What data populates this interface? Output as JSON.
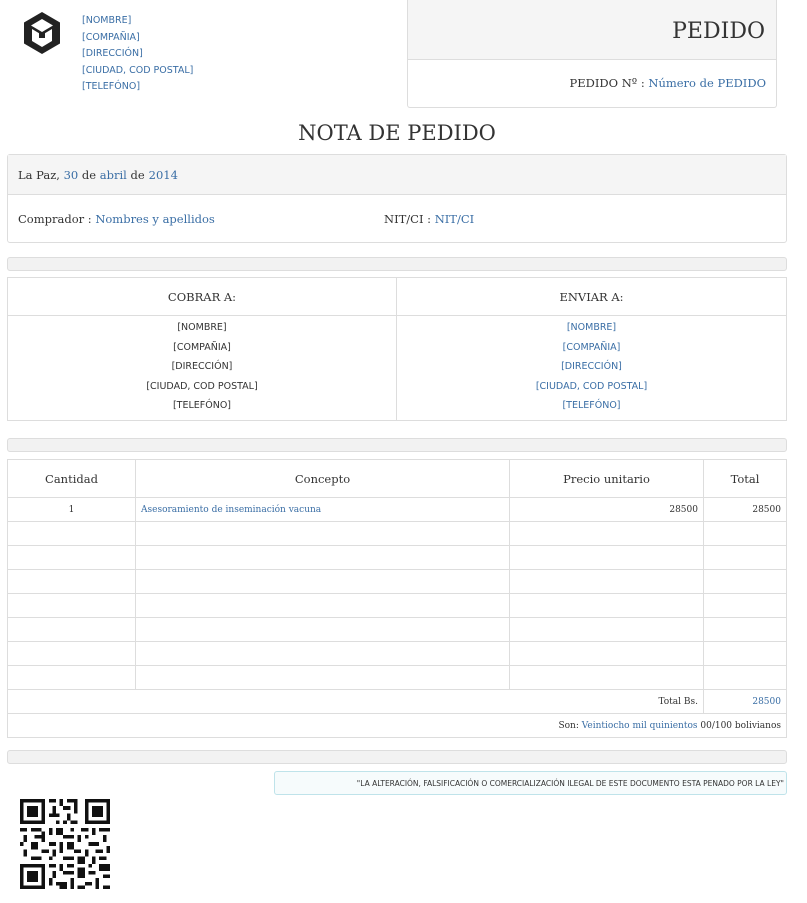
{
  "company": {
    "name": "[NOMBRE]",
    "company": "[COMPAÑIA]",
    "address": "[DIRECCIÓN]",
    "city": "[CIUDAD, COD POSTAL]",
    "phone": "[TELEFÓNO]"
  },
  "order_box": {
    "title": "PEDIDO",
    "number_label": "PEDIDO Nº :",
    "number_value": "Número de PEDIDO"
  },
  "doc_title": "NOTA DE PEDIDO",
  "date": {
    "city": "La Paz,",
    "day": "30",
    "de1": "de",
    "month": "abril",
    "de2": "de",
    "year": "2014"
  },
  "buyer": {
    "label": "Comprador :",
    "value": "Nombres y apellidos",
    "nit_label": "NIT/CI :",
    "nit_value": "NIT/CI"
  },
  "bill_to": {
    "header": "COBRAR A:",
    "name": "[NOMBRE]",
    "company": "[COMPAÑIA]",
    "address": "[DIRECCIÓN]",
    "city": "[CIUDAD, COD POSTAL]",
    "phone": "[TELEFÓNO]"
  },
  "ship_to": {
    "header": "ENVIAR A:",
    "name": "[NOMBRE]",
    "company": "[COMPAÑIA]",
    "address": "[DIRECCIÓN]",
    "city": "[CIUDAD, COD POSTAL]",
    "phone": "[TELEFÓNO]"
  },
  "items": {
    "headers": [
      "Cantidad",
      "Concepto",
      "Precio unitario",
      "Total"
    ],
    "rows": [
      {
        "qty": "1",
        "concept": "Asesoramiento de inseminación vacuna",
        "unit": "28500",
        "total": "28500"
      }
    ]
  },
  "totals": {
    "label": "Total Bs.",
    "value": "28500",
    "words_label": "Son:",
    "words_value": "Veintiocho mil quinientos",
    "words_suffix": "00/100 bolivianos"
  },
  "legal": "\"LA ALTERACIÓN, FALSIFICACIÓN O COMERCIALIZACIÓN ILEGAL DE ESTE DOCUMENTO ESTA PENADO POR LA LEY\"",
  "colors": {
    "link": "#3a6ea5",
    "panel_bg": "#f5f5f5",
    "border": "#dddddd",
    "legal_border": "#bfe3ea"
  },
  "icons": {
    "logo": "unity-cube-logo",
    "qr": "qr-code"
  }
}
